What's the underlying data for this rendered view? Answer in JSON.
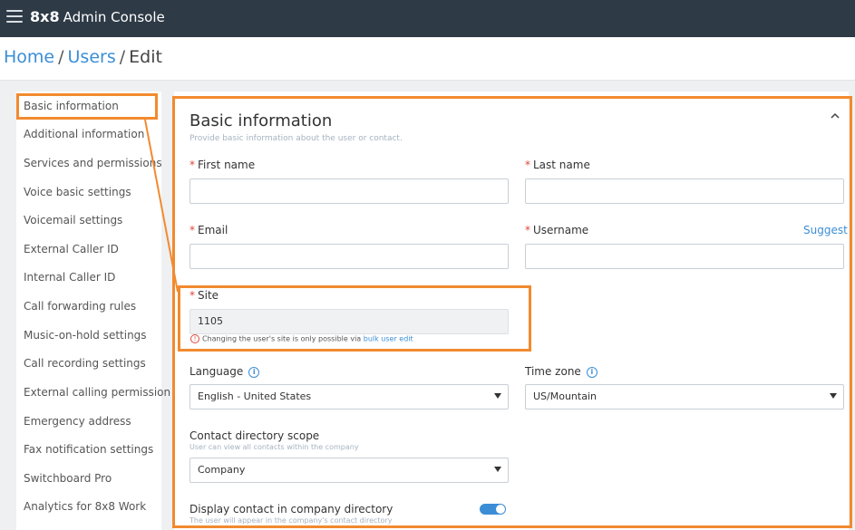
{
  "topbar": {
    "brand_bold": "8x8",
    "brand_text": "Admin Console"
  },
  "breadcrumb": {
    "home": "Home",
    "users": "Users",
    "current": "Edit",
    "separator": "/"
  },
  "sidebar": {
    "items": [
      {
        "label": "Basic information"
      },
      {
        "label": "Additional information"
      },
      {
        "label": "Services and permissions"
      },
      {
        "label": "Voice basic settings"
      },
      {
        "label": "Voicemail settings"
      },
      {
        "label": "External Caller ID"
      },
      {
        "label": "Internal Caller ID"
      },
      {
        "label": "Call forwarding rules"
      },
      {
        "label": "Music-on-hold settings"
      },
      {
        "label": "Call recording settings"
      },
      {
        "label": "External calling permission"
      },
      {
        "label": "Emergency address"
      },
      {
        "label": "Fax notification settings"
      },
      {
        "label": "Switchboard Pro"
      },
      {
        "label": "Analytics for 8x8 Work"
      }
    ]
  },
  "form": {
    "title": "Basic information",
    "subtitle": "Provide basic information about the user or contact.",
    "required_mark": "*",
    "first_name": {
      "label": "First name",
      "value": ""
    },
    "last_name": {
      "label": "Last name",
      "value": ""
    },
    "email": {
      "label": "Email",
      "value": ""
    },
    "username": {
      "label": "Username",
      "value": "",
      "suggest": "Suggest"
    },
    "site": {
      "label": "Site",
      "value": "1105",
      "warning_text": "Changing the user's site is only possible via",
      "warning_link": "bulk user edit",
      "warning_icon": "!"
    },
    "language": {
      "label": "Language",
      "value": "English - United States",
      "info_icon": "i"
    },
    "time_zone": {
      "label": "Time zone",
      "value": "US/Mountain",
      "info_icon": "i"
    },
    "contact_scope": {
      "label": "Contact directory scope",
      "hint": "User can view all contacts within the company",
      "value": "Company"
    },
    "display_contact": {
      "label": "Display contact in company directory",
      "hint": "The user will appear in the company's contact directory",
      "enabled": true
    }
  },
  "colors": {
    "highlight": "#f28a2e",
    "accent": "#3b8ed6",
    "topbar": "#2e3a46",
    "required": "#e0463a"
  }
}
